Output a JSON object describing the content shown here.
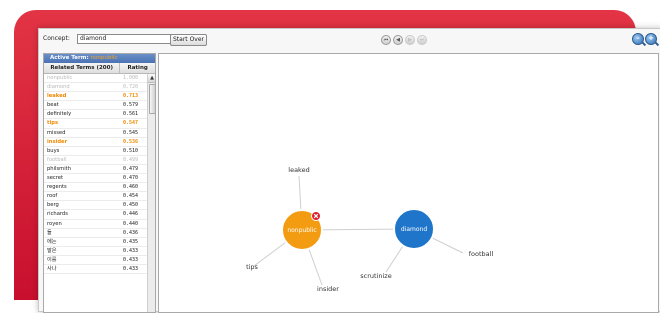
{
  "toolbar": {
    "concept_label": "Concept:",
    "concept_value": "diamond",
    "start_over_label": "Start Over",
    "nav_icons": [
      "first-icon",
      "back-icon",
      "forward-icon",
      "last-icon"
    ],
    "zoom_icons": [
      "zoom-out-icon",
      "zoom-in-icon"
    ]
  },
  "panel": {
    "active_term_label": "Active Term:",
    "active_term_value": "nonpublic",
    "col_term": "Related Terms (200)",
    "col_rating": "Rating",
    "rows": [
      {
        "term": "nonpublic",
        "rating": "1.000",
        "state": "dim"
      },
      {
        "term": "diamond",
        "rating": "0.720",
        "state": "dim"
      },
      {
        "term": "leaked",
        "rating": "0.713",
        "state": "hl"
      },
      {
        "term": "beat",
        "rating": "0.579",
        "state": ""
      },
      {
        "term": "definitely",
        "rating": "0.561",
        "state": ""
      },
      {
        "term": "tips",
        "rating": "0.547",
        "state": "hl"
      },
      {
        "term": "missed",
        "rating": "0.545",
        "state": ""
      },
      {
        "term": "insider",
        "rating": "0.536",
        "state": "hl"
      },
      {
        "term": "buys",
        "rating": "0.510",
        "state": ""
      },
      {
        "term": "football",
        "rating": "0.499",
        "state": "dim"
      },
      {
        "term": "philsmith",
        "rating": "0.479",
        "state": ""
      },
      {
        "term": "secret",
        "rating": "0.470",
        "state": ""
      },
      {
        "term": "regents",
        "rating": "0.460",
        "state": ""
      },
      {
        "term": "roof",
        "rating": "0.454",
        "state": ""
      },
      {
        "term": "berg",
        "rating": "0.450",
        "state": ""
      },
      {
        "term": "richards",
        "rating": "0.446",
        "state": ""
      },
      {
        "term": "royen",
        "rating": "0.440",
        "state": ""
      },
      {
        "term": "들",
        "rating": "0.436",
        "state": ""
      },
      {
        "term": "에는",
        "rating": "0.435",
        "state": ""
      },
      {
        "term": "말은",
        "rating": "0.433",
        "state": ""
      },
      {
        "term": "이를",
        "rating": "0.433",
        "state": ""
      },
      {
        "term": "사나",
        "rating": "0.433",
        "state": ""
      }
    ]
  },
  "graph": {
    "colors": {
      "active_node": "#f39c12",
      "concept_node": "#1f75c9",
      "remove_badge": "#e0202d"
    },
    "nodes": [
      {
        "id": "nonpublic",
        "label": "nonpublic",
        "kind": "active"
      },
      {
        "id": "diamond",
        "label": "diamond",
        "kind": "concept"
      }
    ],
    "terms": [
      {
        "id": "leaked",
        "label": "leaked",
        "link": "nonpublic"
      },
      {
        "id": "tips",
        "label": "tips",
        "link": "nonpublic"
      },
      {
        "id": "insider",
        "label": "insider",
        "link": "nonpublic"
      },
      {
        "id": "scrutinize",
        "label": "scrutinize",
        "link": "diamond"
      },
      {
        "id": "football",
        "label": "football",
        "link": "diamond"
      }
    ]
  }
}
